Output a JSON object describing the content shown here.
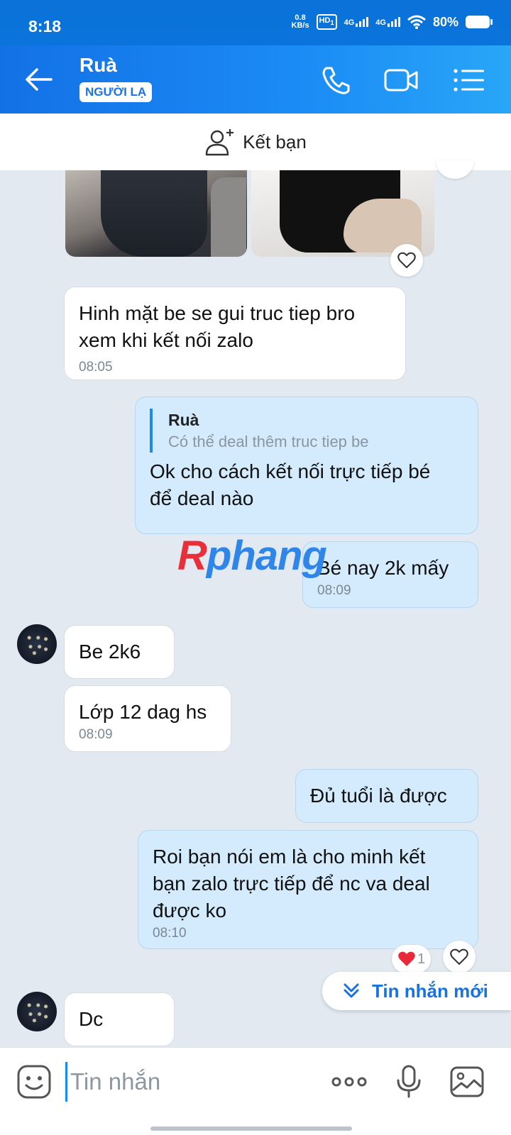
{
  "status_bar": {
    "time": "8:18",
    "speed_value": "0.8",
    "speed_unit": "KB/s",
    "hd": "HD",
    "hd_sub": "1",
    "net1": "4G",
    "net2": "4G",
    "battery": "80%"
  },
  "header": {
    "name": "Ruà",
    "badge": "NGƯỜI LẠ"
  },
  "add_friend": {
    "label": "Kết bạn"
  },
  "messages": [
    {
      "dir": "in",
      "lines": [
        "Hinh mặt be se gui truc tiep bro",
        "xem khi kết nối zalo"
      ],
      "time": "08:05"
    },
    {
      "dir": "out",
      "quote_name": "Ruà",
      "quote_text": "Có thể deal thêm truc tiep be",
      "lines": [
        "Ok cho cách kết nối trực tiếp bé",
        "để deal nào"
      ]
    },
    {
      "dir": "out",
      "lines": [
        "Bé nay 2k mấy"
      ],
      "time": "08:09"
    },
    {
      "dir": "in",
      "lines": [
        "Be 2k6"
      ]
    },
    {
      "dir": "in",
      "lines": [
        "Lớp 12 dag hs"
      ],
      "time": "08:09"
    },
    {
      "dir": "out",
      "lines": [
        "Đủ tuổi là được"
      ]
    },
    {
      "dir": "out",
      "lines": [
        "Roi bạn nói em là cho minh kết",
        "bạn zalo trực tiếp để nc va deal",
        "được ko"
      ],
      "time": "08:10"
    },
    {
      "dir": "in",
      "lines": [
        "Dc"
      ]
    }
  ],
  "reaction": {
    "count": "1"
  },
  "watermark": {
    "part1": "R",
    "part2": "phang"
  },
  "new_messages": {
    "label": "Tin nhắn mới"
  },
  "composer": {
    "placeholder": "Tin nhắn"
  },
  "colors": {
    "header_blue": "#1b8cf5",
    "outgoing_bubble": "#d3ebfc",
    "incoming_bubble": "#ffffff",
    "chat_background": "#e2e9f1",
    "accent": "#1773e4"
  },
  "icons": [
    "back-arrow-icon",
    "phone-icon",
    "video-call-icon",
    "menu-icon",
    "add-user-icon",
    "heart-icon",
    "chevron-double-down-icon",
    "emoji-icon",
    "more-icon",
    "microphone-icon",
    "image-icon"
  ]
}
